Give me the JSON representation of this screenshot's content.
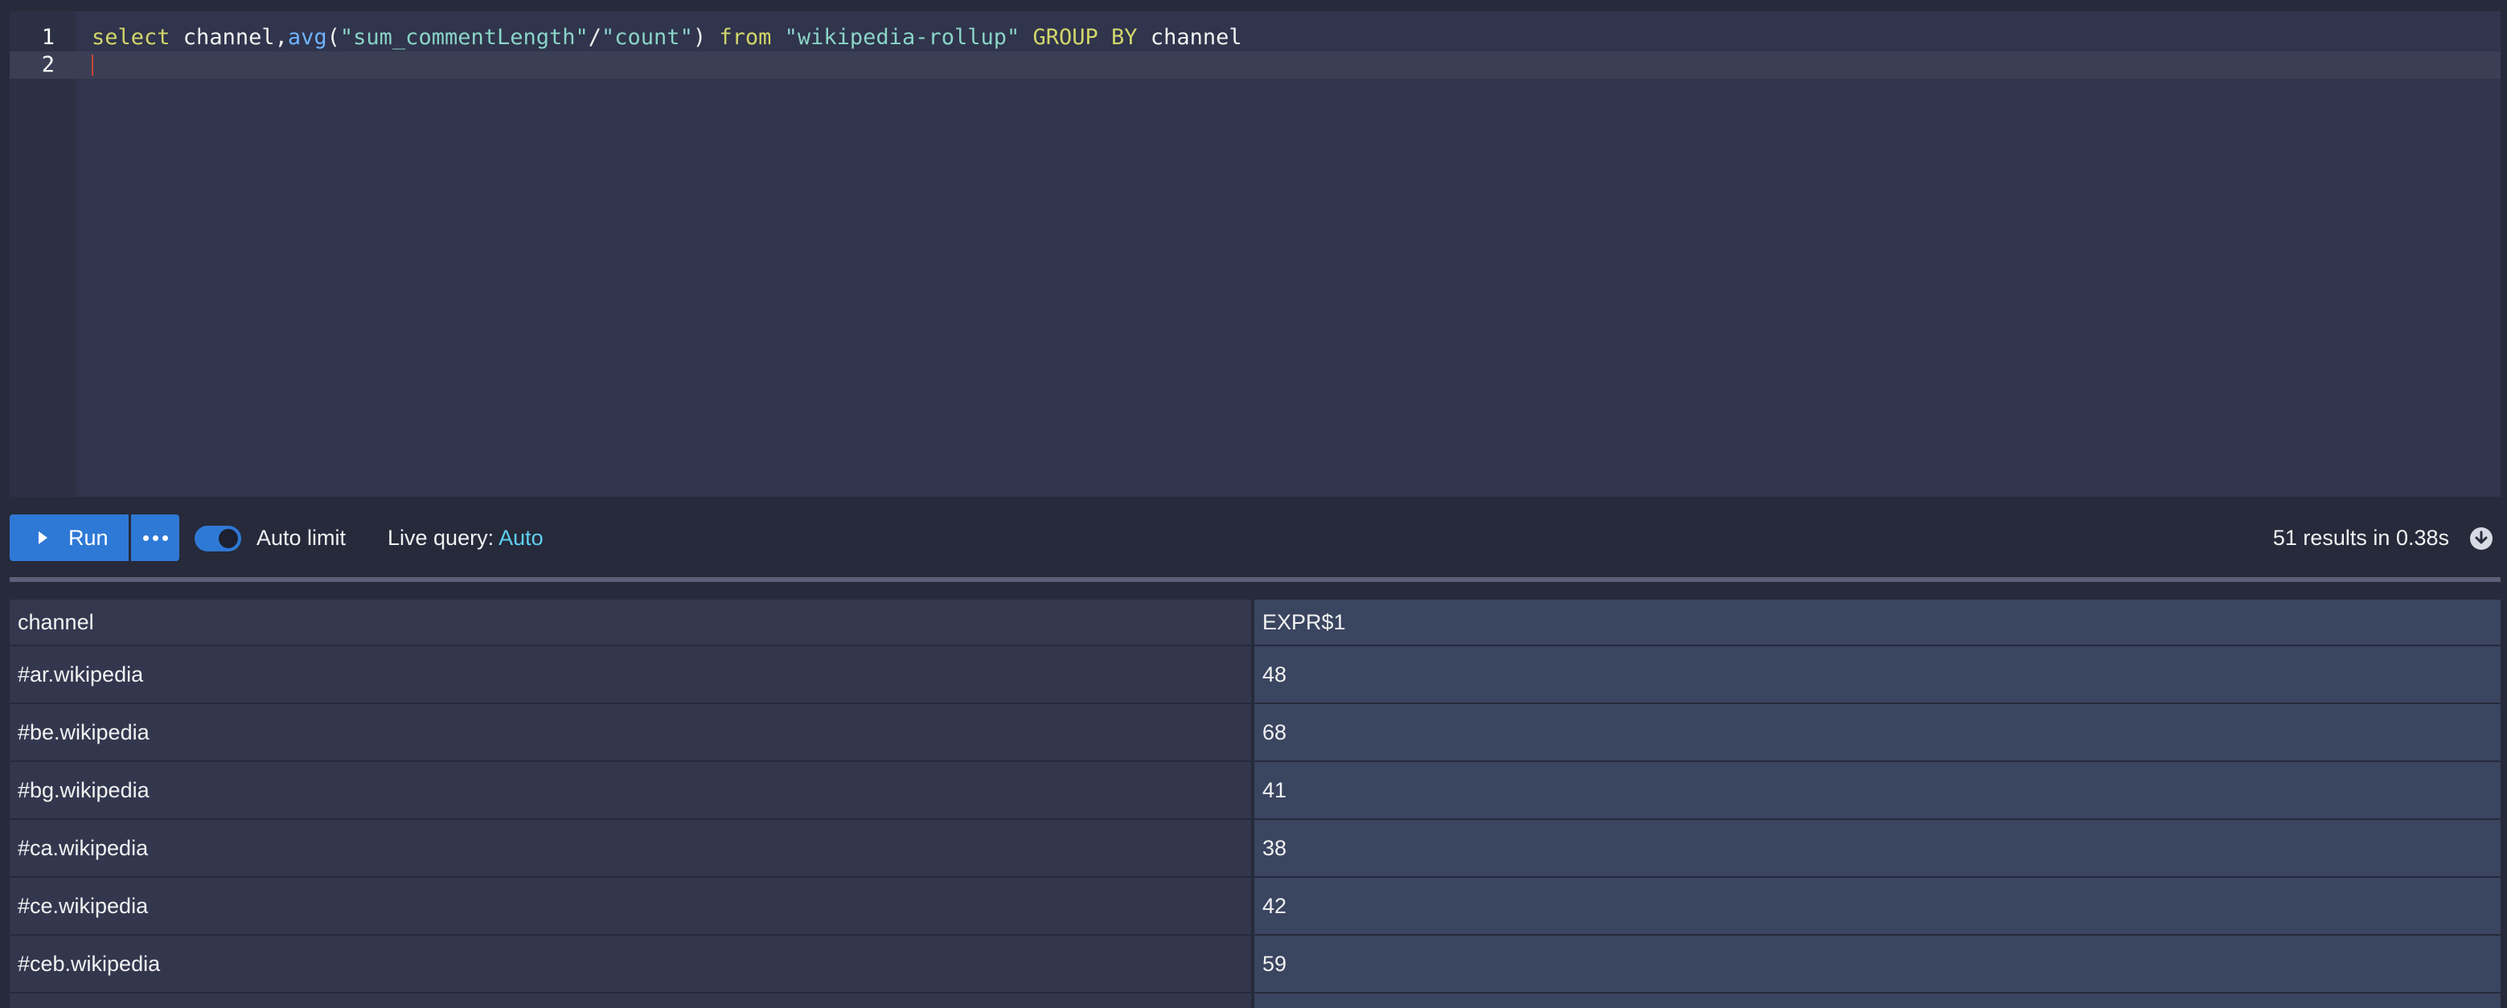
{
  "editor": {
    "line_numbers": [
      "1",
      "2"
    ],
    "line1_tokens": [
      {
        "text": "select",
        "kind": "kw"
      },
      {
        "text": " channel,",
        "kind": "id"
      },
      {
        "text": "avg",
        "kind": "fn"
      },
      {
        "text": "(",
        "kind": "op"
      },
      {
        "text": "\"sum_commentLength\"",
        "kind": "str"
      },
      {
        "text": "/",
        "kind": "op"
      },
      {
        "text": "\"count\"",
        "kind": "str"
      },
      {
        "text": ") ",
        "kind": "op"
      },
      {
        "text": "from",
        "kind": "kw"
      },
      {
        "text": " ",
        "kind": "op"
      },
      {
        "text": "\"wikipedia-rollup\"",
        "kind": "str"
      },
      {
        "text": " ",
        "kind": "op"
      },
      {
        "text": "GROUP BY",
        "kind": "kw"
      },
      {
        "text": " channel",
        "kind": "id"
      }
    ]
  },
  "toolbar": {
    "run_label": "Run",
    "auto_limit_label": "Auto limit",
    "auto_limit_on": true,
    "live_query_label": "Live query: ",
    "live_query_value": "Auto",
    "results_summary": "51 results in 0.38s"
  },
  "table": {
    "columns": [
      "channel",
      "EXPR$1"
    ],
    "rows": [
      [
        "#ar.wikipedia",
        "48"
      ],
      [
        "#be.wikipedia",
        "68"
      ],
      [
        "#bg.wikipedia",
        "41"
      ],
      [
        "#ca.wikipedia",
        "38"
      ],
      [
        "#ce.wikipedia",
        "42"
      ],
      [
        "#ceb.wikipedia",
        "59"
      ]
    ]
  },
  "colors": {
    "accent": "#2f79d6",
    "keyword": "#d2d66a",
    "function": "#6fb3ff",
    "string": "#8ad4c7",
    "live_query_value": "#5fd0f0"
  },
  "icons": {
    "run": "play-icon",
    "more": "more-horizontal-icon",
    "download": "download-circle-icon"
  }
}
